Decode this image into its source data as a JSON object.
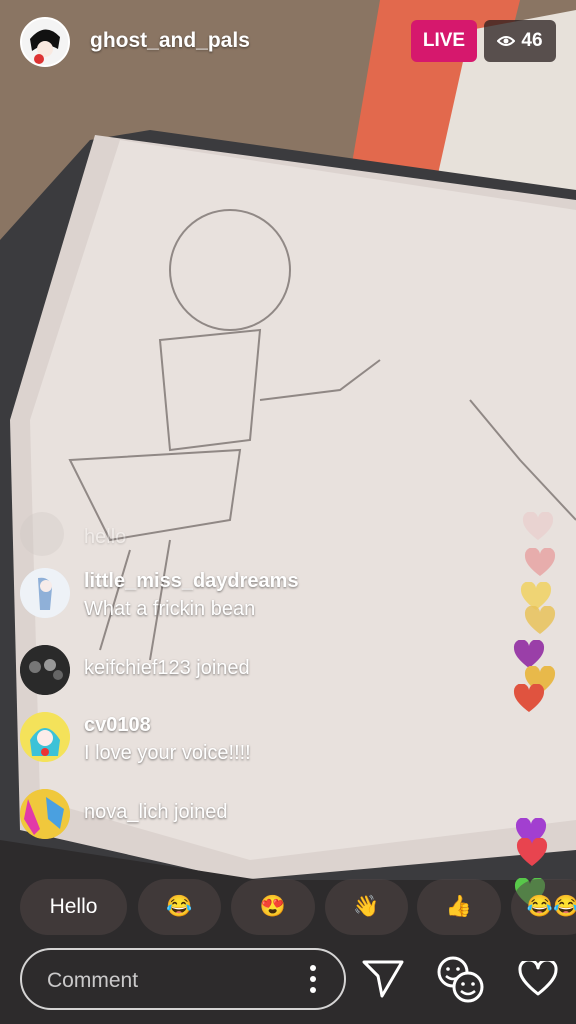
{
  "host": {
    "username": "ghost_and_pals"
  },
  "status": {
    "live_label": "LIVE",
    "viewer_count": "46",
    "viewer_icon": "eye-icon"
  },
  "comments": [
    {
      "type": "comment",
      "user": "",
      "text": "hello",
      "faded": true
    },
    {
      "type": "comment",
      "user": "little_miss_daydreams",
      "text": "What a frickin bean"
    },
    {
      "type": "join",
      "text": "keifchief123 joined"
    },
    {
      "type": "comment",
      "user": "cv0108",
      "text": "I love your voice!!!!"
    },
    {
      "type": "join",
      "text": "nova_lich joined"
    }
  ],
  "quick_reactions": [
    "Hello",
    "😂",
    "😍",
    "👋",
    "👍",
    "😂😂"
  ],
  "composer": {
    "placeholder": "Comment",
    "send_icon": "send-icon",
    "qa_icon": "question-faces-icon",
    "like_icon": "heart-icon"
  },
  "colors": {
    "live": "#d6186d",
    "heart_colors": [
      "#e9c9c9",
      "#e6a0a0",
      "#f0d15a",
      "#e8c25a",
      "#9a3fa8",
      "#e8b94a",
      "#e0533f",
      "#a23fd0",
      "#e8444f",
      "#58c84a"
    ]
  }
}
